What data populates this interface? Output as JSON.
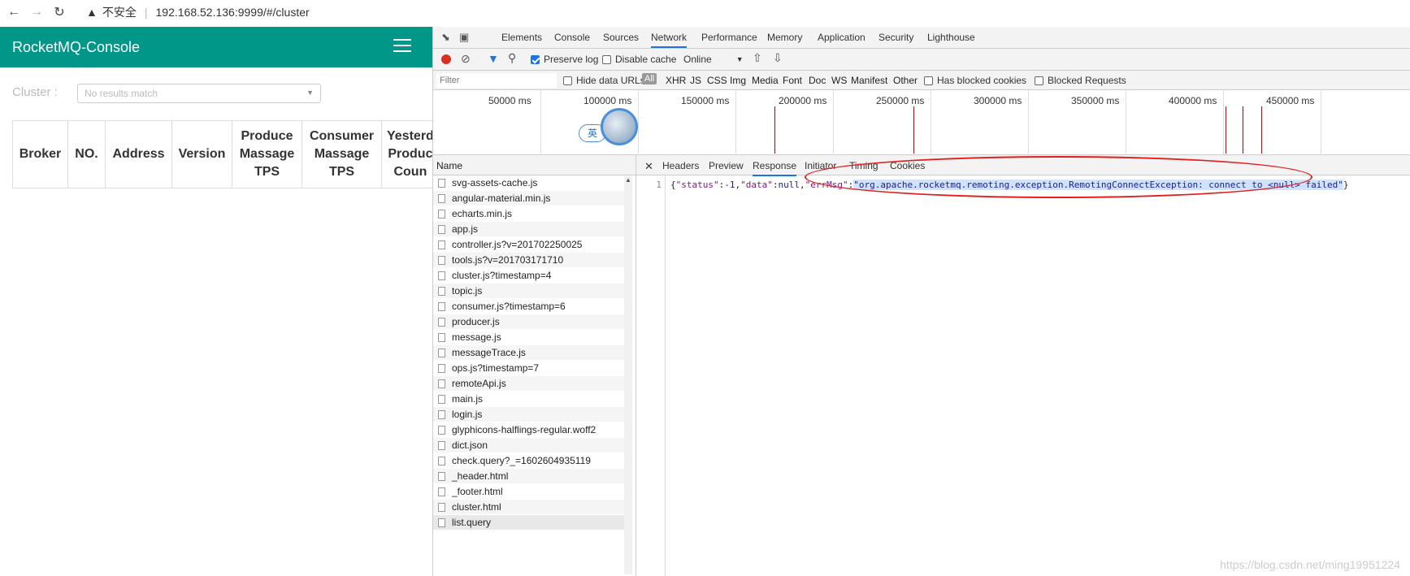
{
  "browser": {
    "back_icon": "arrow-left-icon",
    "forward_icon": "arrow-right-icon",
    "reload_icon": "reload-icon",
    "security_label": "不安全",
    "url": "192.168.52.136:9999/#/cluster"
  },
  "app": {
    "title": "RocketMQ-Console",
    "cluster_label": "Cluster :",
    "cluster_placeholder": "No results match",
    "table_headers": [
      "Broker",
      "NO.",
      "Address",
      "Version",
      "Produce Massage TPS",
      "Consumer Massage TPS",
      "Yesterd Produc Coun"
    ]
  },
  "devtools": {
    "tabs": [
      "Elements",
      "Console",
      "Sources",
      "Network",
      "Performance",
      "Memory",
      "Application",
      "Security",
      "Lighthouse"
    ],
    "active_tab": "Network",
    "toolbar": {
      "preserve_log": "Preserve log",
      "disable_cache": "Disable cache",
      "throttle": "Online"
    },
    "filter": {
      "placeholder": "Filter",
      "hide_data_urls": "Hide data URLs",
      "types": [
        "All",
        "XHR",
        "JS",
        "CSS",
        "Img",
        "Media",
        "Font",
        "Doc",
        "WS",
        "Manifest",
        "Other"
      ],
      "has_blocked_cookies": "Has blocked cookies",
      "blocked_requests": "Blocked Requests"
    },
    "timeline_labels": [
      "50000 ms",
      "100000 ms",
      "150000 ms",
      "200000 ms",
      "250000 ms",
      "300000 ms",
      "350000 ms",
      "400000 ms",
      "450000 ms"
    ],
    "ime_badge": "英",
    "name_header": "Name",
    "requests": [
      "svg-assets-cache.js",
      "angular-material.min.js",
      "echarts.min.js",
      "app.js",
      "controller.js?v=201702250025",
      "tools.js?v=201703171710",
      "cluster.js?timestamp=4",
      "topic.js",
      "consumer.js?timestamp=6",
      "producer.js",
      "message.js",
      "messageTrace.js",
      "ops.js?timestamp=7",
      "remoteApi.js",
      "main.js",
      "login.js",
      "glyphicons-halflings-regular.woff2",
      "dict.json",
      "check.query?_=1602604935119",
      "_header.html",
      "_footer.html",
      "cluster.html",
      "list.query"
    ],
    "detail_tabs": [
      "Headers",
      "Preview",
      "Response",
      "Initiator",
      "Timing",
      "Cookies"
    ],
    "active_detail_tab": "Response",
    "response": {
      "line_number": "1",
      "k_status": "\"status\"",
      "v_status": "-1",
      "k_data": "\"data\"",
      "v_data": "null",
      "k_err": "\"errMsg\"",
      "v_err": "\"org.apache.rocketmq.remoting.exception.RemotingConnectException: connect to <null> failed\""
    }
  },
  "watermark": "https://blog.csdn.net/ming19951224"
}
